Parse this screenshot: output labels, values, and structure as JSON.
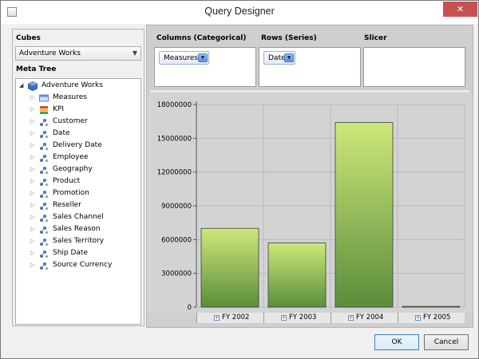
{
  "window": {
    "title": "Query Designer",
    "close_glyph": "✕",
    "app_icon": "window-icon"
  },
  "left": {
    "cubes_label": "Cubes",
    "cube_selected": "Adventure Works",
    "cube_arrow": "▼",
    "meta_tree_label": "Meta Tree",
    "tree": [
      {
        "label": "Adventure Works",
        "icon": "cube-icon",
        "expanded": true,
        "level": 0
      },
      {
        "label": "Measures",
        "icon": "measures-icon",
        "level": 1
      },
      {
        "label": "KPI",
        "icon": "kpi-icon",
        "level": 1
      },
      {
        "label": "Customer",
        "icon": "dimension-icon",
        "level": 1
      },
      {
        "label": "Date",
        "icon": "dimension-icon",
        "level": 1
      },
      {
        "label": "Delivery Date",
        "icon": "dimension-icon",
        "level": 1
      },
      {
        "label": "Employee",
        "icon": "dimension-icon",
        "level": 1
      },
      {
        "label": "Geography",
        "icon": "dimension-icon",
        "level": 1
      },
      {
        "label": "Product",
        "icon": "dimension-icon",
        "level": 1
      },
      {
        "label": "Promotion",
        "icon": "dimension-icon",
        "level": 1
      },
      {
        "label": "Reseller",
        "icon": "dimension-icon",
        "level": 1
      },
      {
        "label": "Sales Channel",
        "icon": "dimension-icon",
        "level": 1
      },
      {
        "label": "Sales Reason",
        "icon": "dimension-icon",
        "level": 1
      },
      {
        "label": "Sales Territory",
        "icon": "dimension-icon",
        "level": 1
      },
      {
        "label": "Ship Date",
        "icon": "dimension-icon",
        "level": 1
      },
      {
        "label": "Source Currency",
        "icon": "dimension-icon",
        "level": 1
      }
    ],
    "expanded_glyph": "◢",
    "collapsed_glyph": "▷"
  },
  "zones": {
    "columns": {
      "title": "Columns (Categorical)",
      "chip": "Measures"
    },
    "rows": {
      "title": "Rows (Series)",
      "chip": "Date"
    },
    "slicer": {
      "title": "Slicer"
    },
    "chip_glyph": "▼"
  },
  "chart_data": {
    "type": "bar",
    "categories": [
      "FY 2002",
      "FY 2003",
      "FY 2004",
      "FY 2005"
    ],
    "values": [
      7000000,
      5700000,
      16400000,
      20000
    ],
    "ylim": [
      0,
      18000000
    ],
    "yticks": [
      0,
      3000000,
      6000000,
      9000000,
      12000000,
      15000000,
      18000000
    ],
    "ytick_labels": [
      "0",
      "3000000",
      "6000000",
      "9000000",
      "12000000",
      "15000000",
      "18000000"
    ],
    "grid": true,
    "expand_glyph": "+",
    "colors": {
      "bar_top": "#cde87a",
      "bar_bottom": "#5c8d3c",
      "grid": "#b8b8b8",
      "plot_bg": "#d3d3d3"
    }
  },
  "footer": {
    "ok": "OK",
    "cancel": "Cancel"
  }
}
